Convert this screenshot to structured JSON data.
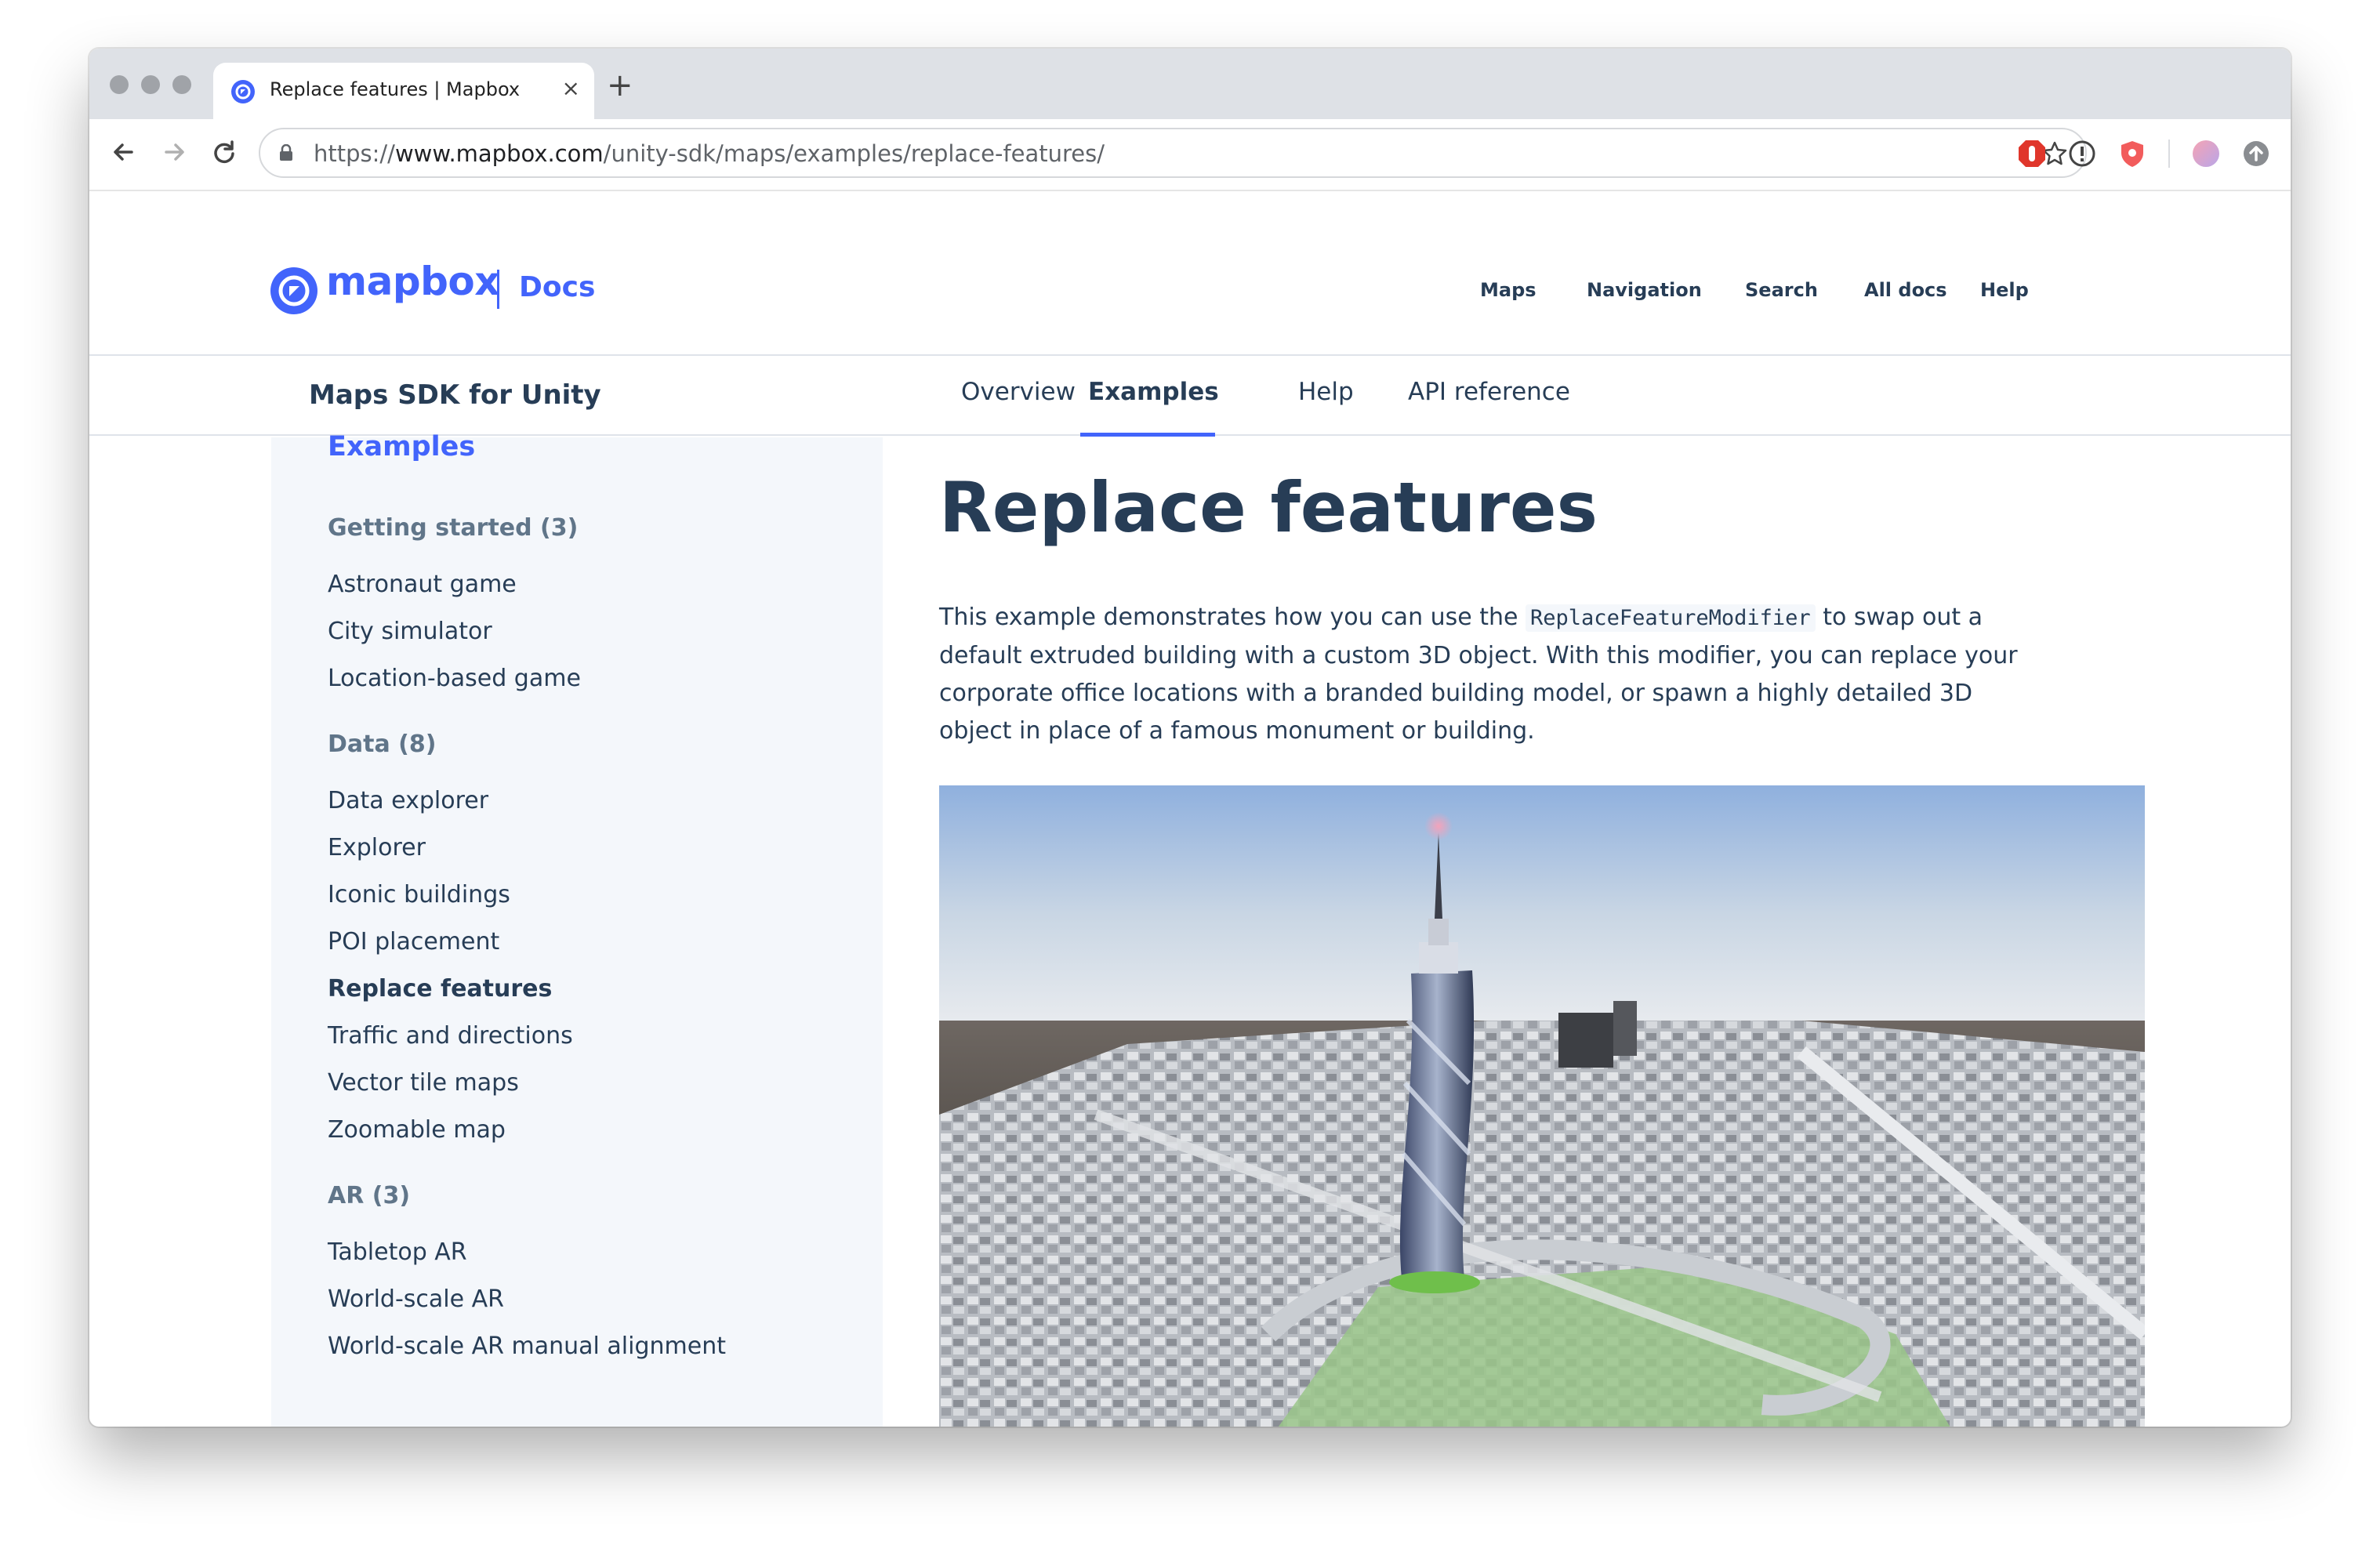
{
  "browser": {
    "tab_title": "Replace features | Mapbox",
    "new_tab": "+",
    "close_tab": "×",
    "url_scheme": "https://",
    "url_host": "www.mapbox.com",
    "url_path": "/unity-sdk/maps/examples/replace-features/"
  },
  "header": {
    "logo_text": "mapbox",
    "docs_label": "Docs",
    "nav": [
      "Maps",
      "Navigation",
      "Search",
      "All docs",
      "Help"
    ]
  },
  "subnav": {
    "product": "Maps SDK for Unity",
    "tabs": [
      "Overview",
      "Examples",
      "Help",
      "API reference"
    ],
    "active_tab": "Examples"
  },
  "sidebar": {
    "heading": "Examples",
    "groups": [
      {
        "title": "Getting started (3)",
        "items": [
          "Astronaut game",
          "City simulator",
          "Location-based game"
        ]
      },
      {
        "title": "Data (8)",
        "items": [
          "Data explorer",
          "Explorer",
          "Iconic buildings",
          "POI placement",
          "Replace features",
          "Traffic and directions",
          "Vector tile maps",
          "Zoomable map"
        ]
      },
      {
        "title": "AR (3)",
        "items": [
          "Tabletop AR",
          "World-scale AR",
          "World-scale AR manual alignment"
        ]
      }
    ],
    "active_item": "Replace features"
  },
  "main": {
    "title": "Replace features",
    "lead_before": "This example demonstrates how you can use the ",
    "lead_code": "ReplaceFeatureModifier",
    "lead_after": " to swap out a default extruded building with a custom 3D object. With this modifier, you can replace your corporate office locations with a branded building model, or spawn a highly detailed 3D object in place of a famous monument or building."
  },
  "colors": {
    "brand_blue": "#4264fb",
    "text_dark": "#273d56",
    "text_muted": "#607589",
    "sidebar_bg": "#f4f7fb"
  },
  "icons": [
    "back-arrow-icon",
    "forward-arrow-icon",
    "reload-icon",
    "lock-icon",
    "bookmark-star-icon",
    "mapbox-logo-icon"
  ]
}
